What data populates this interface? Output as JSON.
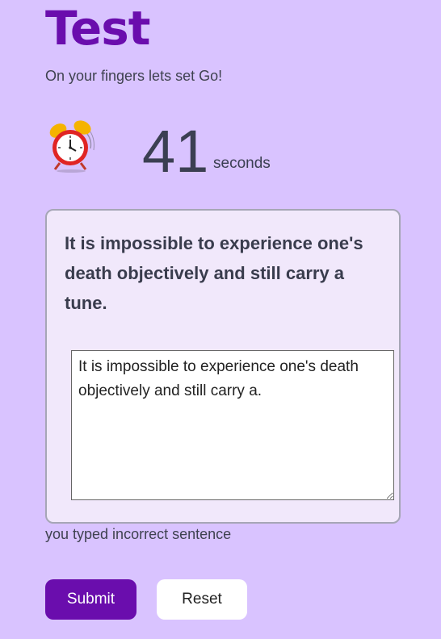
{
  "header": {
    "title": "Test",
    "subtitle": "On your fingers lets set Go!"
  },
  "timer": {
    "icon": "alarm-clock-icon",
    "value": "41",
    "unit": "seconds"
  },
  "test_card": {
    "sentence": "It is impossible to experience one's death objectively and still carry a tune.",
    "typed_text": "It is impossible to experience one's death objectively and still carry a."
  },
  "feedback": {
    "message": "you typed incorrect sentence"
  },
  "actions": {
    "submit_label": "Submit",
    "reset_label": "Reset"
  },
  "colors": {
    "background": "#d9c3ff",
    "accent": "#6a0dad",
    "card_background": "#f1e8fb"
  }
}
